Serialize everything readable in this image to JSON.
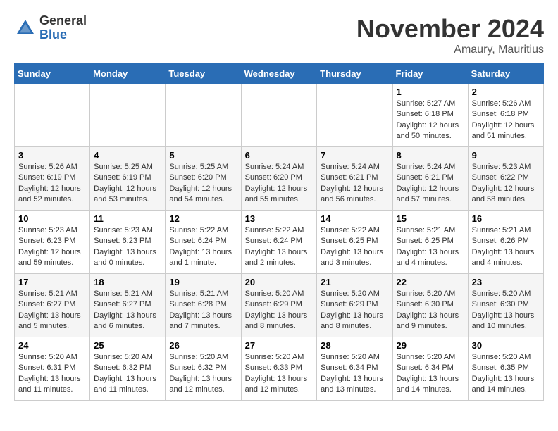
{
  "logo": {
    "general": "General",
    "blue": "Blue"
  },
  "title": {
    "month": "November 2024",
    "location": "Amaury, Mauritius"
  },
  "weekdays": [
    "Sunday",
    "Monday",
    "Tuesday",
    "Wednesday",
    "Thursday",
    "Friday",
    "Saturday"
  ],
  "weeks": [
    [
      {
        "day": "",
        "info": ""
      },
      {
        "day": "",
        "info": ""
      },
      {
        "day": "",
        "info": ""
      },
      {
        "day": "",
        "info": ""
      },
      {
        "day": "",
        "info": ""
      },
      {
        "day": "1",
        "info": "Sunrise: 5:27 AM\nSunset: 6:18 PM\nDaylight: 12 hours and 50 minutes."
      },
      {
        "day": "2",
        "info": "Sunrise: 5:26 AM\nSunset: 6:18 PM\nDaylight: 12 hours and 51 minutes."
      }
    ],
    [
      {
        "day": "3",
        "info": "Sunrise: 5:26 AM\nSunset: 6:19 PM\nDaylight: 12 hours and 52 minutes."
      },
      {
        "day": "4",
        "info": "Sunrise: 5:25 AM\nSunset: 6:19 PM\nDaylight: 12 hours and 53 minutes."
      },
      {
        "day": "5",
        "info": "Sunrise: 5:25 AM\nSunset: 6:20 PM\nDaylight: 12 hours and 54 minutes."
      },
      {
        "day": "6",
        "info": "Sunrise: 5:24 AM\nSunset: 6:20 PM\nDaylight: 12 hours and 55 minutes."
      },
      {
        "day": "7",
        "info": "Sunrise: 5:24 AM\nSunset: 6:21 PM\nDaylight: 12 hours and 56 minutes."
      },
      {
        "day": "8",
        "info": "Sunrise: 5:24 AM\nSunset: 6:21 PM\nDaylight: 12 hours and 57 minutes."
      },
      {
        "day": "9",
        "info": "Sunrise: 5:23 AM\nSunset: 6:22 PM\nDaylight: 12 hours and 58 minutes."
      }
    ],
    [
      {
        "day": "10",
        "info": "Sunrise: 5:23 AM\nSunset: 6:23 PM\nDaylight: 12 hours and 59 minutes."
      },
      {
        "day": "11",
        "info": "Sunrise: 5:23 AM\nSunset: 6:23 PM\nDaylight: 13 hours and 0 minutes."
      },
      {
        "day": "12",
        "info": "Sunrise: 5:22 AM\nSunset: 6:24 PM\nDaylight: 13 hours and 1 minute."
      },
      {
        "day": "13",
        "info": "Sunrise: 5:22 AM\nSunset: 6:24 PM\nDaylight: 13 hours and 2 minutes."
      },
      {
        "day": "14",
        "info": "Sunrise: 5:22 AM\nSunset: 6:25 PM\nDaylight: 13 hours and 3 minutes."
      },
      {
        "day": "15",
        "info": "Sunrise: 5:21 AM\nSunset: 6:25 PM\nDaylight: 13 hours and 4 minutes."
      },
      {
        "day": "16",
        "info": "Sunrise: 5:21 AM\nSunset: 6:26 PM\nDaylight: 13 hours and 4 minutes."
      }
    ],
    [
      {
        "day": "17",
        "info": "Sunrise: 5:21 AM\nSunset: 6:27 PM\nDaylight: 13 hours and 5 minutes."
      },
      {
        "day": "18",
        "info": "Sunrise: 5:21 AM\nSunset: 6:27 PM\nDaylight: 13 hours and 6 minutes."
      },
      {
        "day": "19",
        "info": "Sunrise: 5:21 AM\nSunset: 6:28 PM\nDaylight: 13 hours and 7 minutes."
      },
      {
        "day": "20",
        "info": "Sunrise: 5:20 AM\nSunset: 6:29 PM\nDaylight: 13 hours and 8 minutes."
      },
      {
        "day": "21",
        "info": "Sunrise: 5:20 AM\nSunset: 6:29 PM\nDaylight: 13 hours and 8 minutes."
      },
      {
        "day": "22",
        "info": "Sunrise: 5:20 AM\nSunset: 6:30 PM\nDaylight: 13 hours and 9 minutes."
      },
      {
        "day": "23",
        "info": "Sunrise: 5:20 AM\nSunset: 6:30 PM\nDaylight: 13 hours and 10 minutes."
      }
    ],
    [
      {
        "day": "24",
        "info": "Sunrise: 5:20 AM\nSunset: 6:31 PM\nDaylight: 13 hours and 11 minutes."
      },
      {
        "day": "25",
        "info": "Sunrise: 5:20 AM\nSunset: 6:32 PM\nDaylight: 13 hours and 11 minutes."
      },
      {
        "day": "26",
        "info": "Sunrise: 5:20 AM\nSunset: 6:32 PM\nDaylight: 13 hours and 12 minutes."
      },
      {
        "day": "27",
        "info": "Sunrise: 5:20 AM\nSunset: 6:33 PM\nDaylight: 13 hours and 12 minutes."
      },
      {
        "day": "28",
        "info": "Sunrise: 5:20 AM\nSunset: 6:34 PM\nDaylight: 13 hours and 13 minutes."
      },
      {
        "day": "29",
        "info": "Sunrise: 5:20 AM\nSunset: 6:34 PM\nDaylight: 13 hours and 14 minutes."
      },
      {
        "day": "30",
        "info": "Sunrise: 5:20 AM\nSunset: 6:35 PM\nDaylight: 13 hours and 14 minutes."
      }
    ]
  ]
}
